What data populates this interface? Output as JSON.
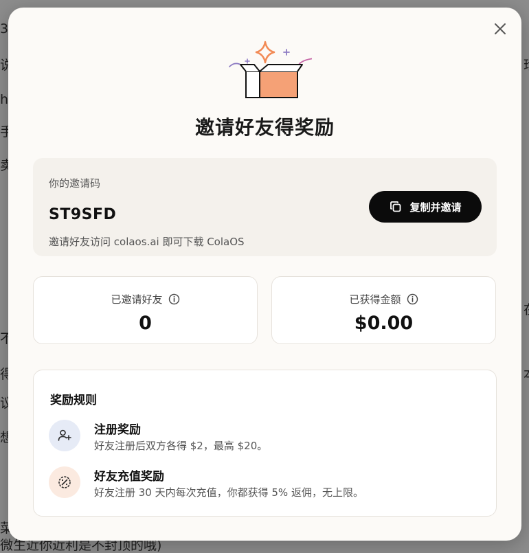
{
  "background": {
    "fragments": [
      "3",
      "说",
      "hc",
      "手",
      "卖",
      "在",
      "不",
      "得",
      "本",
      "议",
      "想",
      "菜",
      "微生近你近利是不封顶的哦)",
      "珍"
    ]
  },
  "modal": {
    "title": "邀请好友得奖励",
    "close_icon": "close-icon",
    "invite": {
      "label": "你的邀请码",
      "code": "ST9SFD",
      "hint": "邀请好友访问 colaos.ai 即可下载 ColaOS",
      "copy_button_label": "复制并邀请",
      "copy_icon": "copy-icon"
    },
    "stats": [
      {
        "label": "已邀请好友",
        "value": "0",
        "icon": "info-icon"
      },
      {
        "label": "已获得金额",
        "value": "$0.00",
        "icon": "info-icon"
      }
    ],
    "rules": {
      "title": "奖励规则",
      "items": [
        {
          "name": "注册奖励",
          "desc": "好友注册后双方各得 $2，最高 $20。",
          "icon": "user-plus-icon",
          "color": "#e6ebf6"
        },
        {
          "name": "好友充值奖励",
          "desc": "好友注册 30 天内每次充值，你都获得 5% 返佣，无上限。",
          "icon": "discount-badge-icon",
          "color": "#fbeae0"
        }
      ]
    }
  },
  "colors": {
    "accent_orange": "#f28a55",
    "button_black": "#0b0b0b",
    "card_beige": "#f4f1ec"
  }
}
